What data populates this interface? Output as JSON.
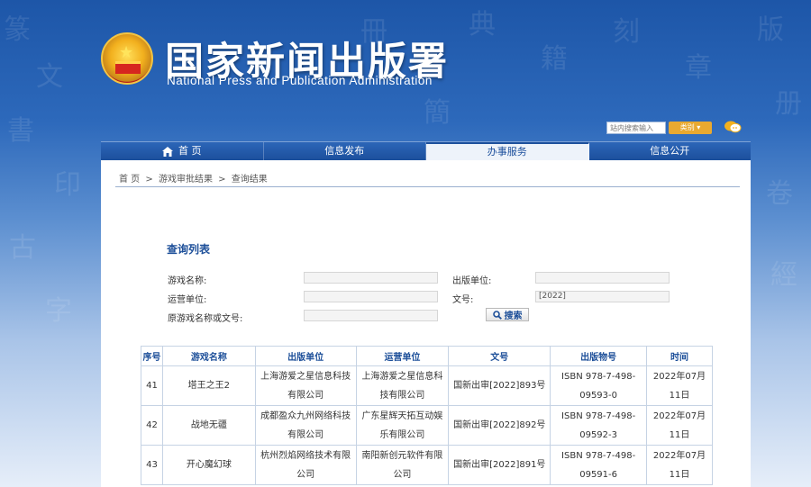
{
  "header": {
    "title": "国家新闻出版署",
    "subtitle": "National Press and Publication Administration",
    "search_placeholder": "站内搜索输入",
    "search_category": "类别"
  },
  "nav": {
    "items": [
      {
        "label": "首 页"
      },
      {
        "label": "信息发布"
      },
      {
        "label": "办事服务"
      },
      {
        "label": "信息公开"
      }
    ]
  },
  "breadcrumb": [
    "首 页",
    ">",
    "游戏审批结果",
    ">",
    "查询结果"
  ],
  "query": {
    "title": "查询列表",
    "game_name_label": "游戏名称:",
    "game_name_value": "",
    "publisher_label": "出版单位:",
    "publisher_value": "",
    "operator_label": "运营单位:",
    "operator_value": "",
    "doc_no_label": "文号:",
    "doc_no_value": "[2022]",
    "orig_label": "原游戏名称或文号:",
    "orig_value": "",
    "search_button": "搜索"
  },
  "table": {
    "headers": [
      "序号",
      "游戏名称",
      "出版单位",
      "运营单位",
      "文号",
      "出版物号",
      "时间"
    ],
    "rows": [
      {
        "no": "41",
        "name": "塔王之王2",
        "publisher": "上海游爱之星信息科技有限公司",
        "operator": "上海游爱之星信息科技有限公司",
        "doc": "国新出审[2022]893号",
        "isbn": "ISBN 978-7-498-09593-0",
        "date": "2022年07月11日"
      },
      {
        "no": "42",
        "name": "战地无疆",
        "publisher": "成都盈众九州网络科技有限公司",
        "operator": "广东星辉天拓互动娱乐有限公司",
        "doc": "国新出审[2022]892号",
        "isbn": "ISBN 978-7-498-09592-3",
        "date": "2022年07月11日"
      },
      {
        "no": "43",
        "name": "开心魔幻球",
        "publisher": "杭州烈焰网络技术有限公司",
        "operator": "南阳新创元软件有限公司",
        "doc": "国新出审[2022]891号",
        "isbn": "ISBN 978-7-498-09591-6",
        "date": "2022年07月11日"
      }
    ]
  }
}
